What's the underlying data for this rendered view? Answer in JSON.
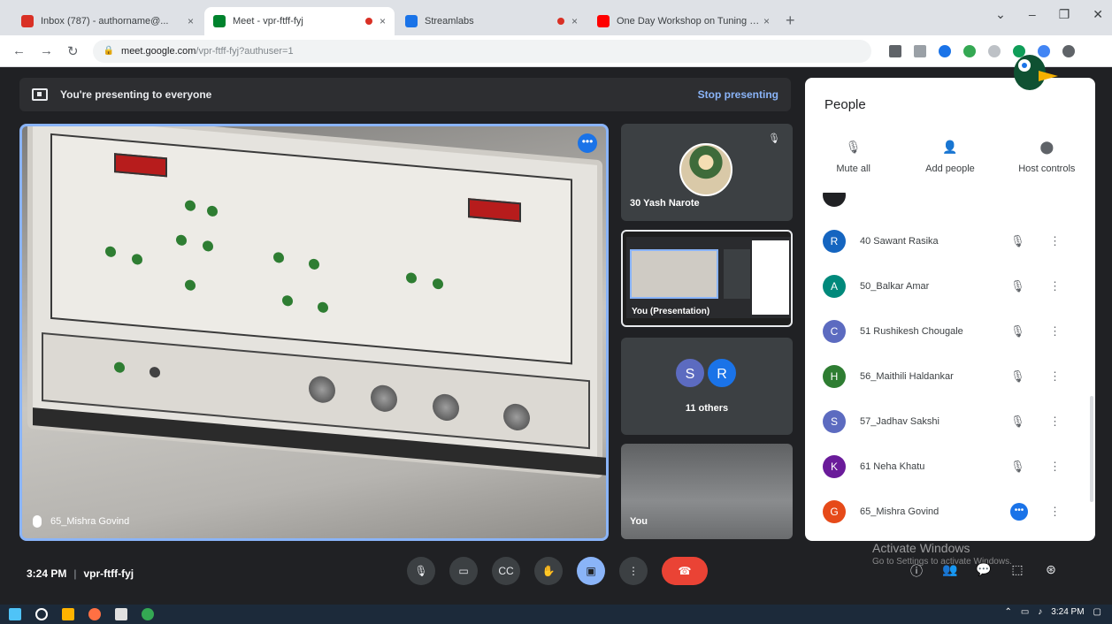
{
  "browser": {
    "tabs": [
      {
        "title": "Inbox (787) - authorname@...",
        "favicon_color": "#d93025",
        "active": false
      },
      {
        "title": "Meet - vpr-ftff-fyj",
        "favicon_color": "#00832d",
        "active": true,
        "recording": true
      },
      {
        "title": "Streamlabs",
        "favicon_color": "#1a73e8",
        "active": false,
        "recording": true
      },
      {
        "title": "One Day Workshop on Tuning of...",
        "favicon_color": "#ff0000",
        "active": false
      }
    ],
    "close_glyph": "×",
    "newtab_glyph": "+",
    "url_host": "meet.google.com",
    "url_path": "/vpr-ftff-fyj?authuser=1"
  },
  "meet": {
    "present_banner": "You're presenting to everyone",
    "stop_presenting": "Stop presenting",
    "main_tile_name": "65_Mishra Govind",
    "tiles": {
      "t1_name": "30 Yash Narote",
      "t2_name": "You (Presentation)",
      "t3_avatars": [
        {
          "letter": "S",
          "color": "#5c6bc0"
        },
        {
          "letter": "R",
          "color": "#1a73e8"
        }
      ],
      "t3_label": "11 others",
      "t4_name": "You"
    },
    "time": "3:24 PM",
    "separator": "|",
    "meeting_code": "vpr-ftff-fyj"
  },
  "people": {
    "title": "People",
    "actions": [
      {
        "label": "Mute all",
        "icon": "mic-off-icon",
        "glyph": "🎙"
      },
      {
        "label": "Add people",
        "icon": "add-person-icon",
        "glyph": "👤"
      },
      {
        "label": "Host controls",
        "icon": "toggle-icon",
        "glyph": "⬤"
      }
    ],
    "participants": [
      {
        "name": "40 Sawant Rasika",
        "letter": "R",
        "color": "#1565c0"
      },
      {
        "name": "50_Balkar Amar",
        "letter": "A",
        "color": "#00897b"
      },
      {
        "name": "51 Rushikesh Chougale",
        "letter": "C",
        "color": "#5c6bc0"
      },
      {
        "name": "56_Maithili Haldankar",
        "letter": "H",
        "color": "#2e7d32"
      },
      {
        "name": "57_Jadhav Sakshi",
        "letter": "S",
        "color": "#5c6bc0"
      },
      {
        "name": "61 Neha Khatu",
        "letter": "K",
        "color": "#6a1b9a"
      },
      {
        "name": "65_Mishra Govind",
        "letter": "G",
        "color": "#e64a19",
        "speaking": true
      }
    ]
  },
  "overlay": {
    "activate_title": "Activate Windows",
    "activate_sub": "Go to Settings to activate Windows."
  },
  "taskbar": {
    "clock": "3:24 PM"
  }
}
